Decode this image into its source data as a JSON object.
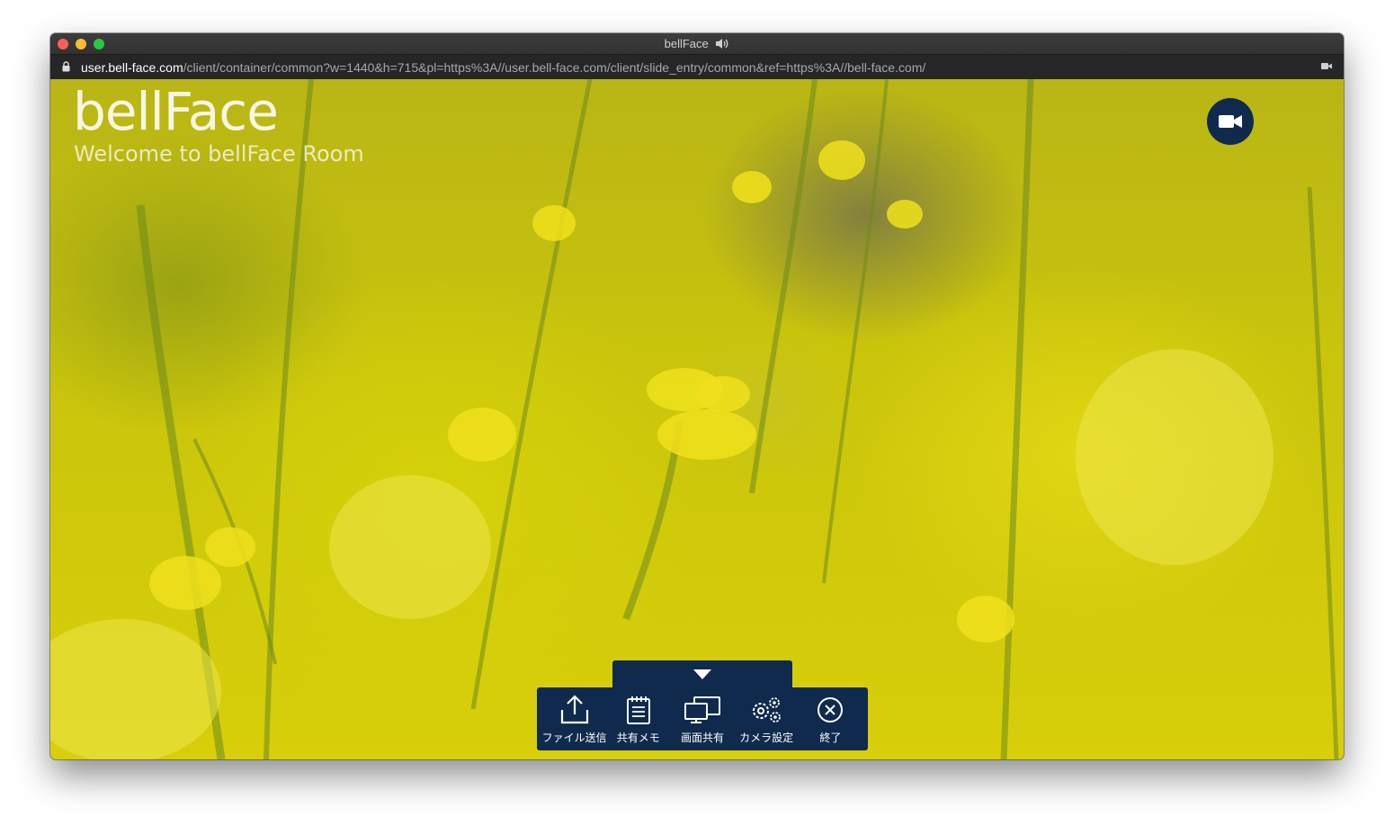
{
  "window": {
    "title": "bellFace",
    "url_host": "user.bell-face.com",
    "url_path": "/client/container/common?w=1440&h=715&pl=https%3A//user.bell-face.com/client/slide_entry/common&ref=https%3A//bell-face.com/"
  },
  "brand": {
    "logo": "bellFace",
    "welcome": "Welcome to bellFace Room"
  },
  "toolbar": {
    "items": [
      {
        "label": "ファイル送信",
        "icon": "upload-icon"
      },
      {
        "label": "共有メモ",
        "icon": "clipboard-icon"
      },
      {
        "label": "画面共有",
        "icon": "screen-share-icon"
      },
      {
        "label": "カメラ設定",
        "icon": "gears-icon"
      },
      {
        "label": "終了",
        "icon": "close-circle-icon"
      }
    ]
  },
  "colors": {
    "toolbar_bg": "#0f2a4d",
    "background": "#c9c40c"
  }
}
